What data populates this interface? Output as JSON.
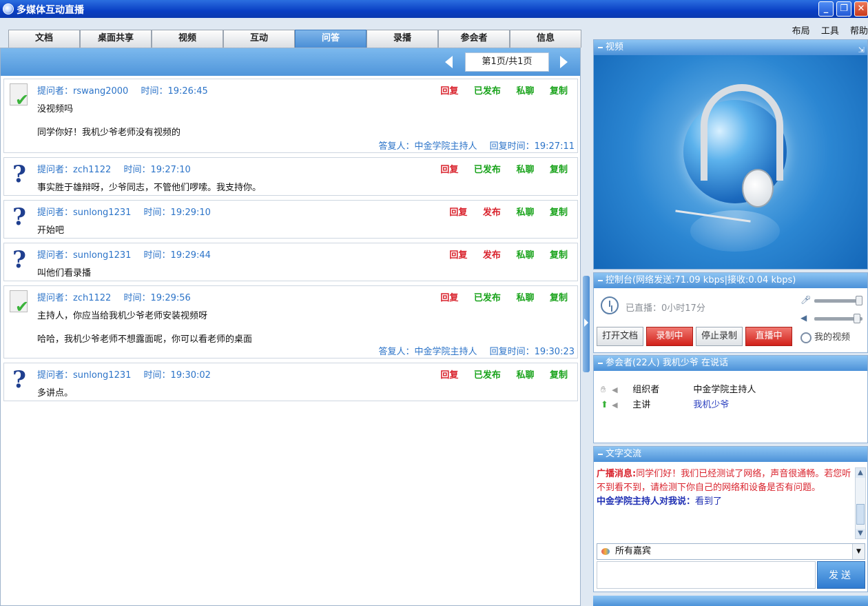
{
  "window": {
    "title": "多媒体互动直播"
  },
  "menu": [
    "布局",
    "工具",
    "帮助"
  ],
  "tabs": [
    {
      "label": "文档",
      "active": false
    },
    {
      "label": "桌面共享",
      "active": false
    },
    {
      "label": "视频",
      "active": false
    },
    {
      "label": "互动",
      "active": false
    },
    {
      "label": "问答",
      "active": true
    },
    {
      "label": "录播",
      "active": false
    },
    {
      "label": "参会者",
      "active": false
    },
    {
      "label": "信息",
      "active": false
    }
  ],
  "pager": {
    "label": "第1页/共1页"
  },
  "actions": {
    "reply": "回复",
    "published": "已发布",
    "publish": "发布",
    "private": "私聊",
    "copy": "复制"
  },
  "questions": [
    {
      "status": "answered",
      "asker": "提问者：rswang2000",
      "time": "时间：19:26:45",
      "publish_state": "已发布",
      "question": "没视频吗",
      "answer": "同学你好！我机少爷老师没有视频的",
      "answerer": "答复人：中金学院主持人",
      "answer_time": "回复时间：19:27:11"
    },
    {
      "status": "open",
      "asker": "提问者：zch1122",
      "time": "时间：19:27:10",
      "publish_state": "已发布",
      "question": "事实胜于雄辩呀，少爷同志，不管他们啰嗦。我支持你。"
    },
    {
      "status": "open",
      "asker": "提问者：sunlong1231",
      "time": "时间：19:29:10",
      "publish_state": "发布",
      "question": "开始吧"
    },
    {
      "status": "open",
      "asker": "提问者：sunlong1231",
      "time": "时间：19:29:44",
      "publish_state": "发布",
      "question": "叫他们看录播"
    },
    {
      "status": "answered",
      "asker": "提问者：zch1122",
      "time": "时间：19:29:56",
      "publish_state": "已发布",
      "question": "主持人，你应当给我机少爷老师安装视频呀",
      "answer": "哈哈，我机少爷老师不想露面呢，你可以看老师的桌面",
      "answerer": "答复人：中金学院主持人",
      "answer_time": "回复时间：19:30:23"
    },
    {
      "status": "open",
      "asker": "提问者：sunlong1231",
      "time": "时间：19:30:02",
      "publish_state": "已发布",
      "question": "多讲点。"
    }
  ],
  "video_panel": {
    "title": "视频"
  },
  "console": {
    "title": "控制台(网络发送:71.09 kbps|接收:0.04 kbps)",
    "live_time": "已直播：0小时17分",
    "open_doc": "打开文档",
    "recording": "录制中",
    "stop_record": "停止录制",
    "live": "直播中",
    "my_video": "我的视频",
    "mic_level": 1.0,
    "speaker_level": 0.95
  },
  "attendees": {
    "title": "参会者(22人) 我机少爷 在说话",
    "list": [
      {
        "role": "组织者",
        "name": "中金学院主持人"
      },
      {
        "role": "主讲",
        "name": "我机少爷"
      }
    ]
  },
  "chat": {
    "title": "文字交流",
    "msg1_label": "广播消息:",
    "msg1_text": "同学们好！我们已经测试了网络，声音很通畅。若您听不到看不到，请检测下你自己的网络和设备是否有问题。",
    "msg2_label": "中金学院主持人对我说：",
    "msg2_text": "看到了",
    "recipient": "所有嘉宾",
    "send": "发送"
  },
  "colors": {
    "accent": "#4c91d8",
    "red": "#d9232d",
    "green": "#19a31b",
    "link": "#2b73c8"
  }
}
